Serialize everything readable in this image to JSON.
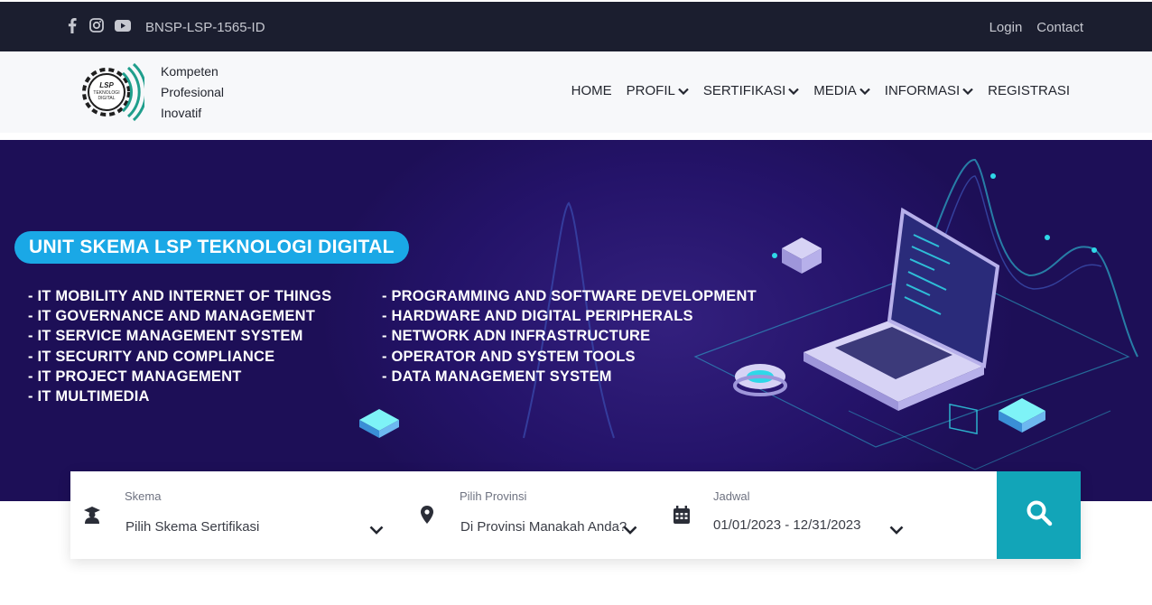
{
  "topbar": {
    "social_icons": [
      "facebook-icon",
      "instagram-icon",
      "youtube-icon"
    ],
    "code": "BNSP-LSP-1565-ID",
    "login": "Login",
    "contact": "Contact"
  },
  "header": {
    "logo_text": [
      "LSP",
      "TEKNOLOGI",
      "DIGITAL"
    ],
    "tagline": [
      "Kompeten",
      "Profesional",
      "Inovatif"
    ],
    "nav": [
      {
        "label": "HOME",
        "dropdown": false
      },
      {
        "label": "PROFIL",
        "dropdown": true
      },
      {
        "label": "SERTIFIKASI",
        "dropdown": true
      },
      {
        "label": "MEDIA",
        "dropdown": true
      },
      {
        "label": "INFORMASI",
        "dropdown": true
      },
      {
        "label": "REGISTRASI",
        "dropdown": false
      }
    ]
  },
  "hero": {
    "badge": "UNIT SKEMA LSP TEKNOLOGI DIGITAL",
    "left_items": [
      "- IT MOBILITY AND INTERNET OF THINGS",
      "- IT GOVERNANCE AND MANAGEMENT",
      "- IT SERVICE MANAGEMENT SYSTEM",
      "- IT SECURITY AND COMPLIANCE",
      "- IT PROJECT MANAGEMENT",
      "- IT MULTIMEDIA"
    ],
    "right_items": [
      "- PROGRAMMING AND SOFTWARE DEVELOPMENT",
      "- HARDWARE AND DIGITAL PERIPHERALS",
      "- NETWORK ADN INFRASTRUCTURE",
      "- OPERATOR AND SYSTEM TOOLS",
      "- DATA MANAGEMENT SYSTEM"
    ],
    "colors": {
      "background": "#1d0f57",
      "badge": "#1aa8e6",
      "accent": "#2fd8e8"
    }
  },
  "search": {
    "skema": {
      "label": "Skema",
      "value": "Pilih Skema Sertifikasi",
      "icon": "graduate-icon"
    },
    "provinsi": {
      "label": "Pilih Provinsi",
      "value": "Di Provinsi Manakah Anda?",
      "icon": "map-pin-icon"
    },
    "jadwal": {
      "label": "Jadwal",
      "value": "01/01/2023 - 12/31/2023",
      "icon": "calendar-icon"
    },
    "button_icon": "search-icon",
    "button_color": "#12a5b8"
  }
}
